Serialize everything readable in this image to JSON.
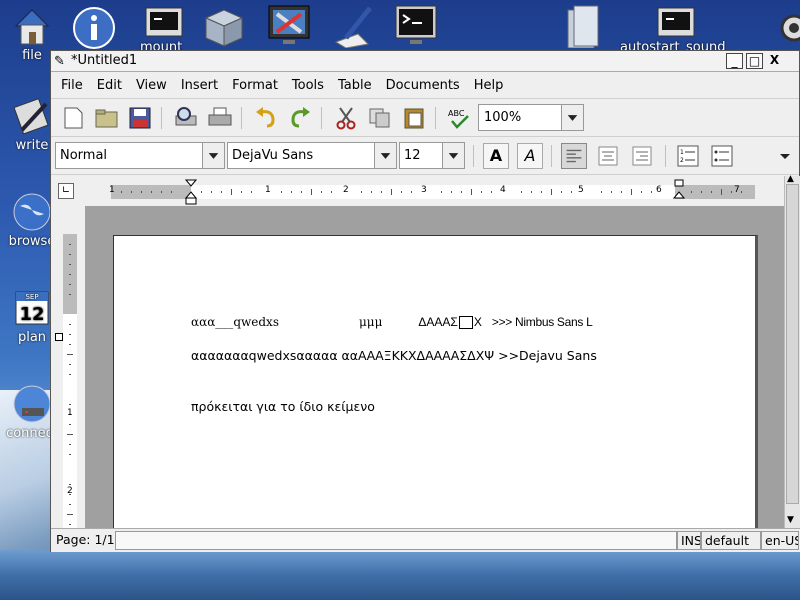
{
  "desktop": {
    "left_icons": [
      {
        "label": "file"
      },
      {
        "label": "write"
      },
      {
        "label": "browse"
      },
      {
        "label": "plan"
      },
      {
        "label": "connect"
      }
    ],
    "top_labels": {
      "mount": "mount",
      "autostart": "autostart_sound"
    },
    "calendar_month": "SEP",
    "calendar_day": "12"
  },
  "window": {
    "title": "*Untitled1",
    "buttons": {
      "minimize": "_",
      "maximize": "□",
      "close": "X"
    }
  },
  "menu": {
    "items": [
      {
        "label": "File"
      },
      {
        "label": "Edit"
      },
      {
        "label": "View"
      },
      {
        "label": "Insert"
      },
      {
        "label": "Format"
      },
      {
        "label": "Tools"
      },
      {
        "label": "Table"
      },
      {
        "label": "Documents"
      },
      {
        "label": "Help"
      }
    ]
  },
  "toolbar": {
    "zoom": "100%",
    "style": "Normal",
    "font": "DejaVu Sans",
    "size": "12",
    "bold_label": "A",
    "italic_label": "A"
  },
  "document": {
    "line1": {
      "a": "ααα___",
      "b": "qwedxs",
      "c": "μμμ",
      "d": "ΔΑΑΑΣ",
      "e": "Χ",
      "f": ">>> Nimbus Sans L"
    },
    "line2": "αααααααqwedxsααααα ααΑΑΑΞΚΚΧΔΑΑΑΑΣΔΧΨ >>Dejavu Sans",
    "line3": "πρόκειται για το ίδιο κείμενο"
  },
  "ruler": {
    "h_labels": [
      "1",
      "1",
      "2",
      "3",
      "4",
      "5",
      "6",
      "7"
    ],
    "v_labels": [
      "1",
      "2"
    ]
  },
  "status": {
    "page": "Page: 1/1",
    "mode": "INS",
    "style": "default",
    "lang": "en-US"
  },
  "colors": {
    "accent": "#1d3d8c"
  }
}
